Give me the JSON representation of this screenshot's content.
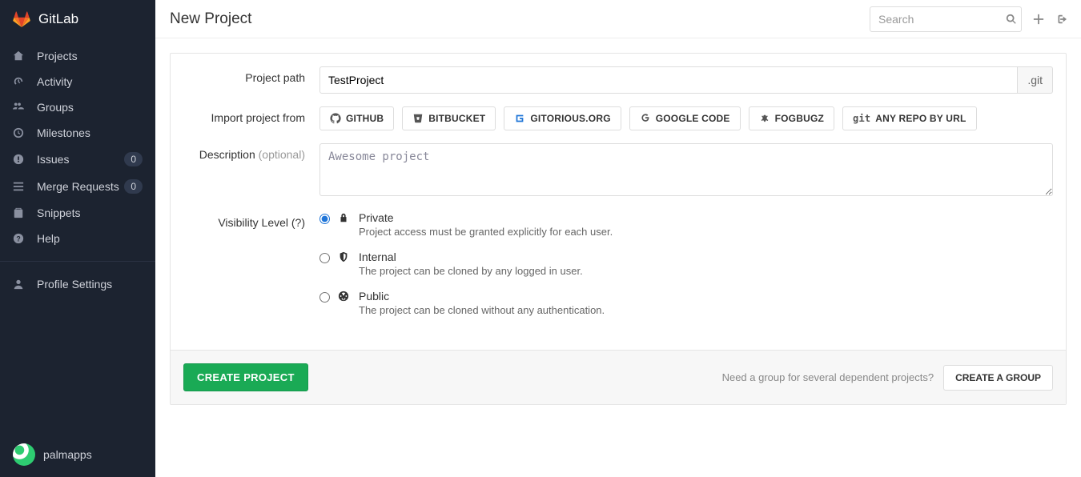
{
  "brand": "GitLab",
  "page_title": "New Project",
  "search": {
    "placeholder": "Search"
  },
  "sidebar": {
    "items": [
      {
        "label": "Projects"
      },
      {
        "label": "Activity"
      },
      {
        "label": "Groups"
      },
      {
        "label": "Milestones"
      },
      {
        "label": "Issues",
        "badge": "0"
      },
      {
        "label": "Merge Requests",
        "badge": "0"
      },
      {
        "label": "Snippets"
      },
      {
        "label": "Help"
      }
    ],
    "profile": {
      "label": "Profile Settings"
    }
  },
  "user": {
    "name": "palmapps"
  },
  "form": {
    "path_label": "Project path",
    "path_value": "TestProject",
    "path_suffix": ".git",
    "import_label": "Import project from",
    "import_buttons": [
      "GITHUB",
      "BITBUCKET",
      "GITORIOUS.ORG",
      "GOOGLE CODE",
      "FOGBUGZ",
      "ANY REPO BY URL"
    ],
    "desc_label": "Description",
    "desc_optional": "(optional)",
    "desc_placeholder": "Awesome project",
    "vis_label": "Visibility Level (?)",
    "visibility": [
      {
        "title": "Private",
        "desc": "Project access must be granted explicitly for each user."
      },
      {
        "title": "Internal",
        "desc": "The project can be cloned by any logged in user."
      },
      {
        "title": "Public",
        "desc": "The project can be cloned without any authentication."
      }
    ],
    "submit": "CREATE PROJECT",
    "group_hint": "Need a group for several dependent projects?",
    "group_btn": "CREATE A GROUP"
  }
}
